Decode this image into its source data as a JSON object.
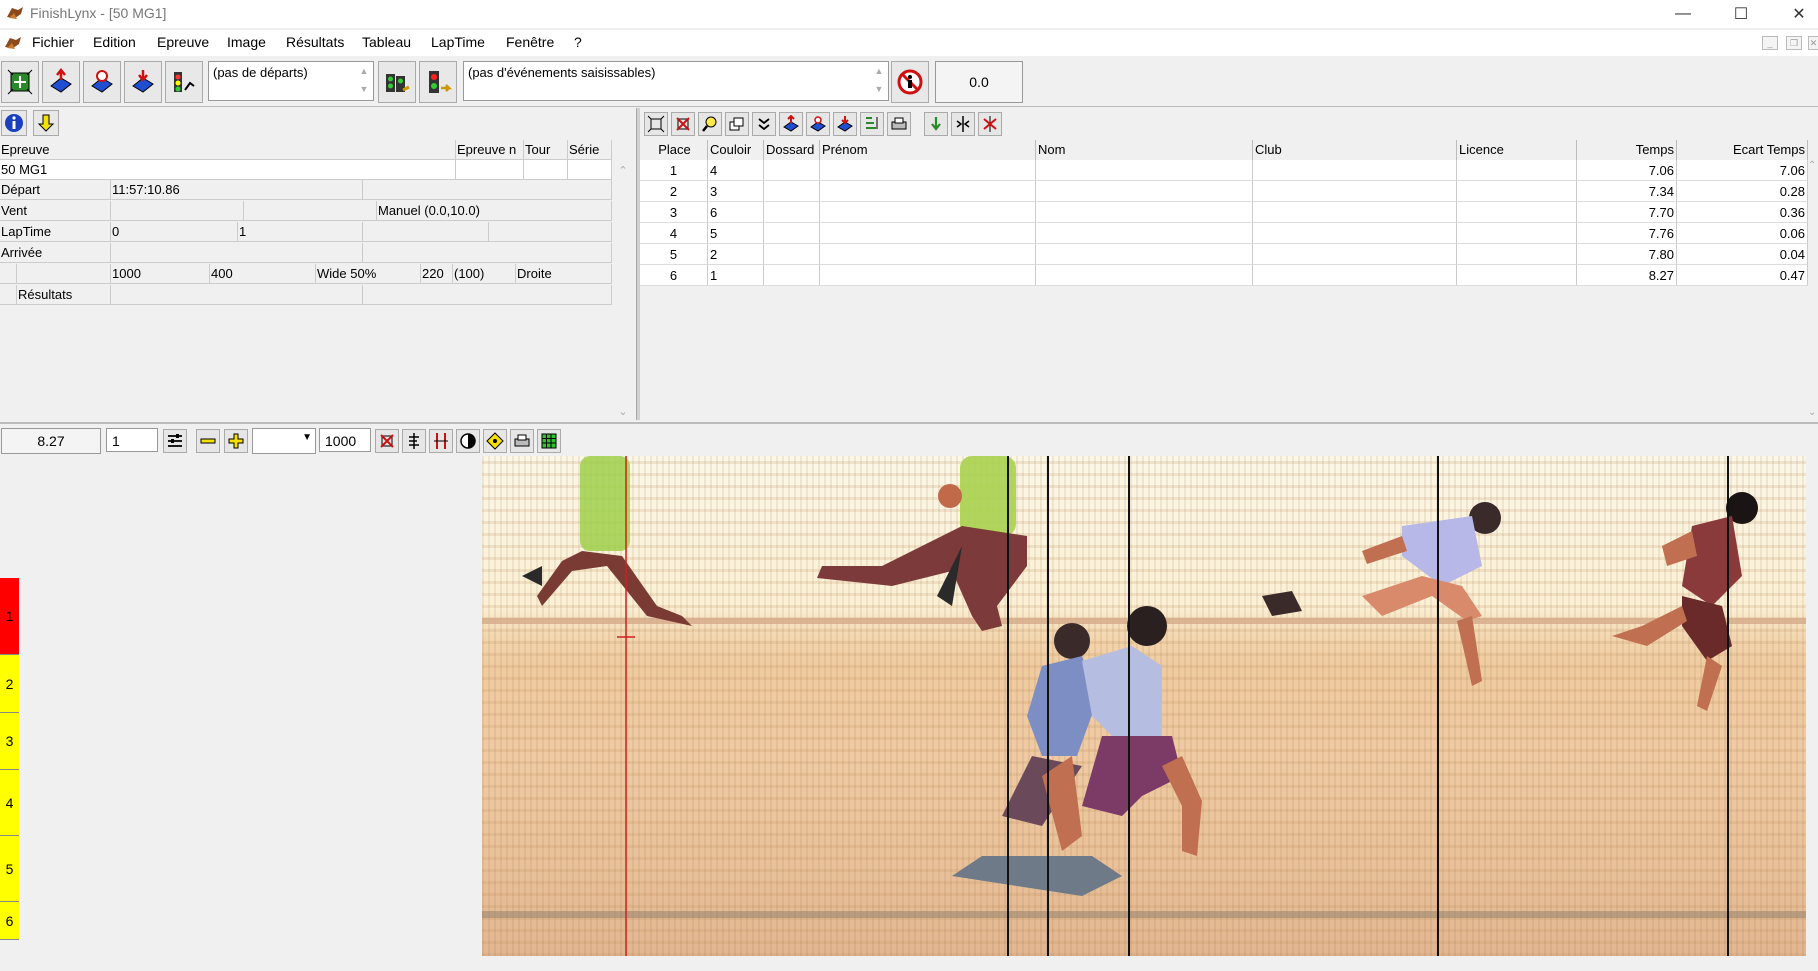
{
  "window": {
    "title": "FinishLynx - [50 MG1]"
  },
  "menu": [
    "Fichier",
    "Edition",
    "Epreuve",
    "Image",
    "Résultats",
    "Tableau",
    "LapTime",
    "Fenêtre",
    "?"
  ],
  "toolbar": {
    "starts_combo": "(pas de départs)",
    "events_combo": "(pas d'événements saisissables)",
    "time_display": "0.0"
  },
  "event_panel": {
    "headers": {
      "epreuve": "Epreuve",
      "epreuve_n": "Epreuve n",
      "tour": "Tour",
      "serie": "Série"
    },
    "event_name": "50 MG1",
    "depart_label": "Départ",
    "depart_value": "11:57:10.86",
    "vent_label": "Vent",
    "vent_value": "Manuel (0.0,10.0)",
    "laptime_label": "LapTime",
    "laptime_a": "0",
    "laptime_b": "1",
    "arrivee_label": "Arrivée",
    "cam_1000": "1000",
    "cam_400": "400",
    "cam_wide": "Wide 50%",
    "cam_220": "220",
    "cam_100": "(100)",
    "cam_dir": "Droite",
    "resultats_label": "Résultats"
  },
  "results": {
    "columns": [
      "Place",
      "Couloir",
      "Dossard",
      "Prénom",
      "Nom",
      "Club",
      "Licence",
      "Temps",
      "Ecart Temps"
    ],
    "rows": [
      {
        "place": "1",
        "couloir": "4",
        "temps": "7.06",
        "ecart": "7.06"
      },
      {
        "place": "2",
        "couloir": "3",
        "temps": "7.34",
        "ecart": "0.28"
      },
      {
        "place": "3",
        "couloir": "6",
        "temps": "7.70",
        "ecart": "0.36"
      },
      {
        "place": "4",
        "couloir": "5",
        "temps": "7.76",
        "ecart": "0.06"
      },
      {
        "place": "5",
        "couloir": "2",
        "temps": "7.80",
        "ecart": "0.04"
      },
      {
        "place": "6",
        "couloir": "1",
        "temps": "8.27",
        "ecart": "0.47"
      }
    ]
  },
  "image_toolbar": {
    "time": "8.27",
    "zoom_field": "1",
    "density_field": "1000"
  },
  "lanes": [
    "1",
    "2",
    "3",
    "4",
    "5",
    "6"
  ],
  "colors": {
    "lane_first": "#ff0000",
    "lane_other": "#ffff00",
    "cursor": "#d02020"
  }
}
